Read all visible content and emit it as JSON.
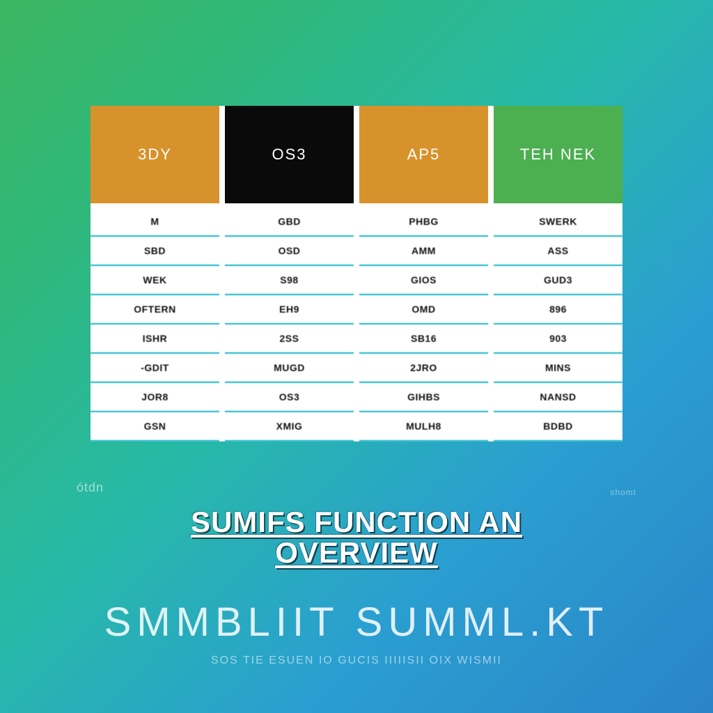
{
  "table": {
    "headers": [
      "3DY",
      "OS3",
      "AP5",
      "TEH NEK"
    ],
    "header_colors": [
      "#d8922b",
      "#0a0a0a",
      "#d8922b",
      "#4caf50"
    ],
    "rows": [
      [
        "M",
        "GBD",
        "PHBG",
        "SWERK"
      ],
      [
        "SBD",
        "OSD",
        "AMM",
        "ASS"
      ],
      [
        "WEK",
        "S98",
        "GIOS",
        "GUD3"
      ],
      [
        "OFTERN",
        "EH9",
        "OMD",
        "896"
      ],
      [
        "ISHR",
        "2SS",
        "SB16",
        "903"
      ],
      [
        "-GDIT",
        "MUGD",
        "2JRO",
        "MINS"
      ],
      [
        "JOR8",
        "OS3",
        "GIHBS",
        "NANSD"
      ],
      [
        "GSN",
        "XMIG",
        "MULH8",
        "BDBD"
      ]
    ]
  },
  "title": "SUMIFS FUNCTION AN OVERVIEW",
  "footer_left": "ótdn",
  "footer_right": "shomt",
  "big_text": "SMMBLIIT  SUMML.KT",
  "sub_text": "SOS  TIE  ESUEN  IO GUCIS  IIIIISII  OIX  WISMII"
}
